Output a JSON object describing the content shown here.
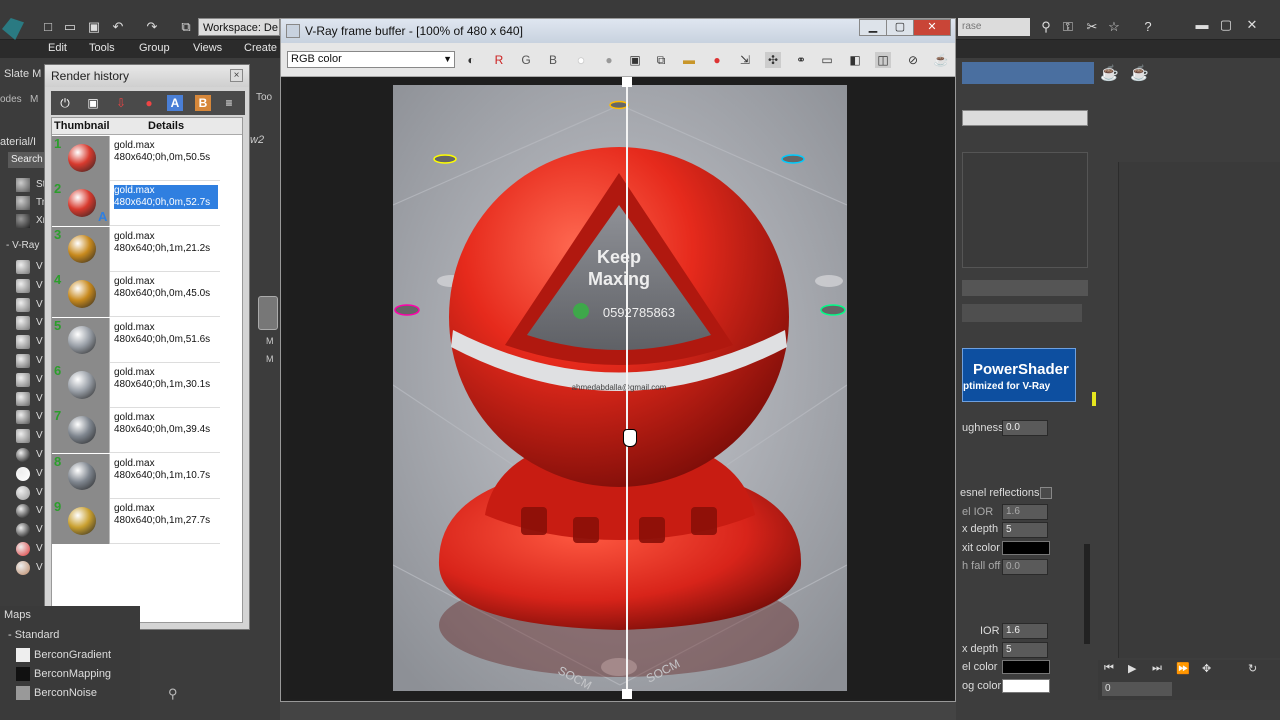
{
  "top": {
    "menu": [
      "Edit",
      "Tools",
      "Group",
      "Views",
      "Create"
    ],
    "workspace_label": "Workspace: De",
    "search_placeholder": "rase"
  },
  "slate": {
    "title": "Slate M",
    "tabs": [
      "odes",
      "M"
    ],
    "material_label": "aterial/I",
    "search_label": "Search",
    "vray_group": "- V-Ray",
    "rows": [
      "St",
      "Tr",
      "Xr"
    ],
    "vray_rows": [
      "V",
      "V",
      "V",
      "V",
      "V",
      "V",
      "V",
      "V",
      "V",
      "V",
      "V",
      "V",
      "V",
      "V",
      "V",
      "V",
      "V"
    ],
    "tool_label": "Too",
    "view_label": "w2",
    "node_labels": [
      "M",
      "M"
    ]
  },
  "render_history": {
    "title": "Render history",
    "columns": [
      "Thumbnail",
      "Details"
    ],
    "items": [
      {
        "num": "1",
        "file": "gold.max",
        "detail": "480x640;0h,0m,50.5s",
        "color": "#d83a2e",
        "selected": false
      },
      {
        "num": "2",
        "file": "gold.max",
        "detail": "480x640;0h,0m,52.7s",
        "color": "#d83a2e",
        "selected": true,
        "badge": "A"
      },
      {
        "num": "3",
        "file": "gold.max",
        "detail": "480x640;0h,1m,21.2s",
        "color": "#c88a1e",
        "selected": false
      },
      {
        "num": "4",
        "file": "gold.max",
        "detail": "480x640;0h,0m,45.0s",
        "color": "#c88a1e",
        "selected": false
      },
      {
        "num": "5",
        "file": "gold.max",
        "detail": "480x640;0h,0m,51.6s",
        "color": "#9aa0a8",
        "selected": false
      },
      {
        "num": "6",
        "file": "gold.max",
        "detail": "480x640;0h,1m,30.1s",
        "color": "#9aa0a8",
        "selected": false
      },
      {
        "num": "7",
        "file": "gold.max",
        "detail": "480x640;0h,0m,39.4s",
        "color": "#7f868f",
        "selected": false
      },
      {
        "num": "8",
        "file": "gold.max",
        "detail": "480x640;0h,1m,10.7s",
        "color": "#7f868f",
        "selected": false
      },
      {
        "num": "9",
        "file": "gold.max",
        "detail": "480x640;0h,1m,27.7s",
        "color": "#c9a030",
        "selected": false
      }
    ]
  },
  "vfb": {
    "title": "V-Ray frame buffer - [100% of 480 x 640]",
    "channel": "RGB color",
    "channels": [
      "R",
      "G",
      "B"
    ]
  },
  "render": {
    "logo_line1": "Keep",
    "logo_line2": "Maxing",
    "phone": "0592785863",
    "email": "ahmedabdalla@gmail.com",
    "floor_text": "SOCM"
  },
  "right": {
    "powershader_title": "PowerShader",
    "powershader_sub": "ptimized for V-Ray",
    "roughness_label": "ughness",
    "roughness_value": "0.0",
    "fresnel_label": "esnel reflections",
    "ior_label_1": "el IOR",
    "ior_value_1": "1.6",
    "depth_label_1": "x depth",
    "depth_value_1": "5",
    "exit_color_label": "xit color",
    "falloff_label": "h fall off",
    "falloff_value": "0.0",
    "ior_label_2": "IOR",
    "ior_value_2": "1.6",
    "depth_label_2": "x depth",
    "depth_value_2": "5",
    "color_label": "el color",
    "fog_label": "og color",
    "frame_value": "0"
  },
  "maps": {
    "title": "Maps",
    "group": "- Standard",
    "items": [
      "BerconGradient",
      "BerconMapping",
      "BerconNoise"
    ]
  }
}
